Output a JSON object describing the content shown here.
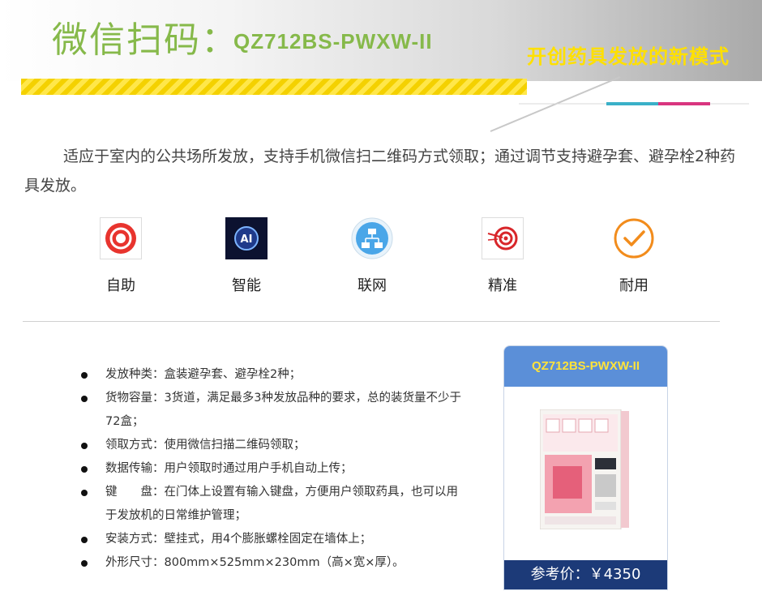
{
  "header": {
    "title": "微信扫码：",
    "model": "QZ712BS-PWXW-II",
    "slogan": "开创药具发放的新模式"
  },
  "intro": "适应于室内的公共场所发放，支持手机微信扫二维码方式领取；通过调节支持避孕套、避孕栓2种药具发放。",
  "features": [
    {
      "label": "自助",
      "icon": "stop-button-icon"
    },
    {
      "label": "智能",
      "icon": "ai-chip-icon"
    },
    {
      "label": "联网",
      "icon": "network-icon"
    },
    {
      "label": "精准",
      "icon": "target-icon"
    },
    {
      "label": "耐用",
      "icon": "checkmark-icon"
    }
  ],
  "specs": [
    "发放种类：盒装避孕套、避孕栓2种；",
    "货物容量：3货道，满足最多3种发放品种的要求，总的装货量不少于72盒；",
    "领取方式：使用微信扫描二维码领取；",
    "数据传输：用户领取时通过用户手机自动上传；",
    "键　　盘：在门体上设置有输入键盘，方便用户领取药具，也可以用于发放机的日常维护管理；",
    "安装方式：壁挂式，用4个膨胀螺栓固定在墙体上；",
    "外形尺寸：800mm×525mm×230mm（高×宽×厚）。"
  ],
  "product": {
    "model": "QZ712BS-PWXW-II",
    "price": "参考价：￥4350",
    "image": "wall-mounted-dispenser-machine"
  },
  "colors": {
    "title_green": "#86b94a",
    "slogan_yellow": "#ffe000",
    "card_blue": "#5b8fd8",
    "price_navy": "#1c3a78"
  }
}
